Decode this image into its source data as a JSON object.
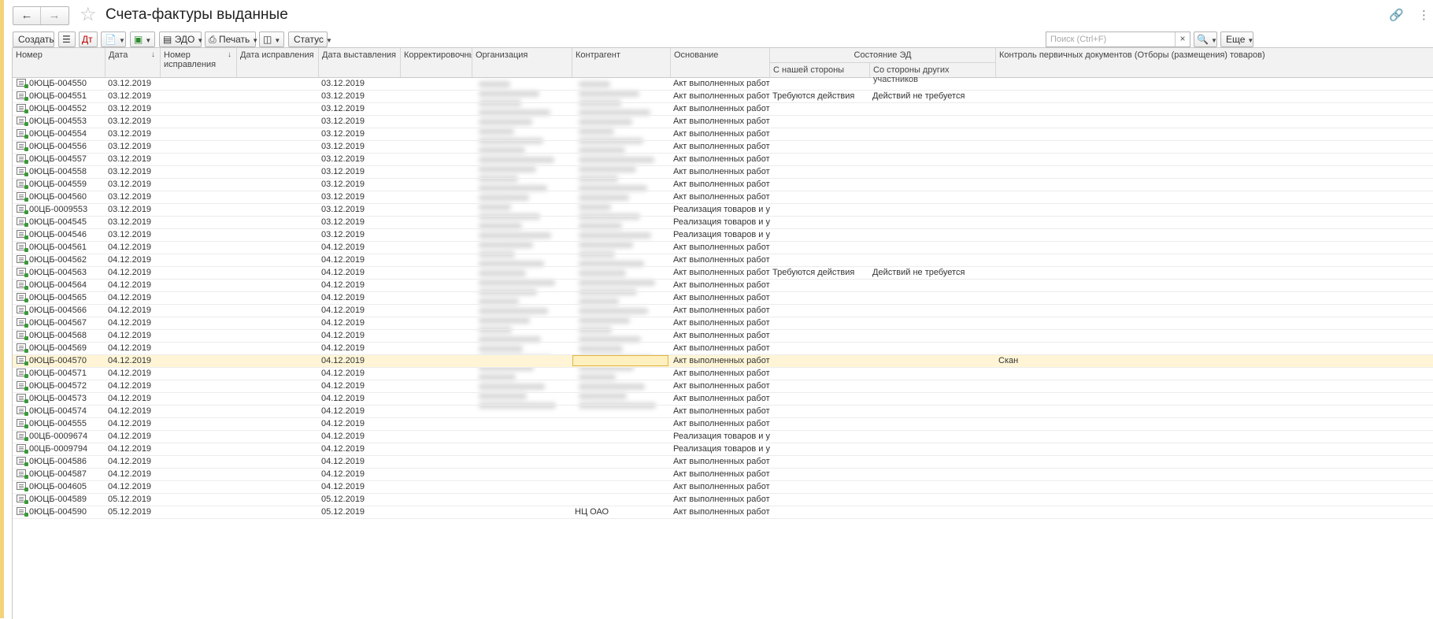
{
  "window": {
    "title": "Счета-фактуры выданные"
  },
  "toolbar": {
    "create_label": "Создать",
    "edo_label": "ЭДО",
    "print_label": "Печать",
    "status_label": "Статус",
    "search_placeholder": "Поиск (Ctrl+F)",
    "more_label": "Еще"
  },
  "columns": {
    "number": "Номер",
    "date": "Дата",
    "corr_number": "Номер исправления",
    "corr_date": "Дата исправления",
    "issue_date": "Дата выставления",
    "corrective": "Корректировочный",
    "organization": "Организация",
    "counterparty": "Контрагент",
    "basis": "Основание",
    "ed_state": "Состояние ЭД",
    "our_side": "С нашей стороны",
    "other_side": "Со стороны других участников",
    "control": "Контроль первичных документов (Отборы (размещения) товаров)"
  },
  "rows": [
    {
      "number": "0ЮЦБ-004550",
      "date": "03.12.2019",
      "issue": "03.12.2019",
      "basis": "Акт выполненных работ ...",
      "our": "",
      "other": "",
      "control": ""
    },
    {
      "number": "0ЮЦБ-004551",
      "date": "03.12.2019",
      "issue": "03.12.2019",
      "basis": "Акт выполненных работ ...",
      "our": "Требуются действия",
      "other": "Действий не требуется",
      "control": ""
    },
    {
      "number": "0ЮЦБ-004552",
      "date": "03.12.2019",
      "issue": "03.12.2019",
      "basis": "Акт выполненных работ ...",
      "our": "",
      "other": "",
      "control": ""
    },
    {
      "number": "0ЮЦБ-004553",
      "date": "03.12.2019",
      "issue": "03.12.2019",
      "basis": "Акт выполненных работ ...",
      "our": "",
      "other": "",
      "control": ""
    },
    {
      "number": "0ЮЦБ-004554",
      "date": "03.12.2019",
      "issue": "03.12.2019",
      "basis": "Акт выполненных работ ...",
      "our": "",
      "other": "",
      "control": ""
    },
    {
      "number": "0ЮЦБ-004556",
      "date": "03.12.2019",
      "issue": "03.12.2019",
      "basis": "Акт выполненных работ ...",
      "our": "",
      "other": "",
      "control": ""
    },
    {
      "number": "0ЮЦБ-004557",
      "date": "03.12.2019",
      "issue": "03.12.2019",
      "basis": "Акт выполненных работ ...",
      "our": "",
      "other": "",
      "control": ""
    },
    {
      "number": "0ЮЦБ-004558",
      "date": "03.12.2019",
      "issue": "03.12.2019",
      "basis": "Акт выполненных работ ...",
      "our": "",
      "other": "",
      "control": ""
    },
    {
      "number": "0ЮЦБ-004559",
      "date": "03.12.2019",
      "issue": "03.12.2019",
      "basis": "Акт выполненных работ ...",
      "our": "",
      "other": "",
      "control": ""
    },
    {
      "number": "0ЮЦБ-004560",
      "date": "03.12.2019",
      "issue": "03.12.2019",
      "basis": "Акт выполненных работ ...",
      "our": "",
      "other": "",
      "control": ""
    },
    {
      "number": "00ЦБ-0009553",
      "date": "03.12.2019",
      "issue": "03.12.2019",
      "basis": "Реализация товаров и ус...",
      "our": "",
      "other": "",
      "control": ""
    },
    {
      "number": "0ЮЦБ-004545",
      "date": "03.12.2019",
      "issue": "03.12.2019",
      "basis": "Реализация товаров и ус...",
      "our": "",
      "other": "",
      "control": ""
    },
    {
      "number": "0ЮЦБ-004546",
      "date": "03.12.2019",
      "issue": "03.12.2019",
      "basis": "Реализация товаров и ус...",
      "our": "",
      "other": "",
      "control": ""
    },
    {
      "number": "0ЮЦБ-004561",
      "date": "04.12.2019",
      "issue": "04.12.2019",
      "basis": "Акт выполненных работ ...",
      "our": "",
      "other": "",
      "control": ""
    },
    {
      "number": "0ЮЦБ-004562",
      "date": "04.12.2019",
      "issue": "04.12.2019",
      "basis": "Акт выполненных работ ...",
      "our": "",
      "other": "",
      "control": ""
    },
    {
      "number": "0ЮЦБ-004563",
      "date": "04.12.2019",
      "issue": "04.12.2019",
      "basis": "Акт выполненных работ ...",
      "our": "Требуются действия",
      "other": "Действий не требуется",
      "control": ""
    },
    {
      "number": "0ЮЦБ-004564",
      "date": "04.12.2019",
      "issue": "04.12.2019",
      "basis": "Акт выполненных работ ...",
      "our": "",
      "other": "",
      "control": ""
    },
    {
      "number": "0ЮЦБ-004565",
      "date": "04.12.2019",
      "issue": "04.12.2019",
      "basis": "Акт выполненных работ ...",
      "our": "",
      "other": "",
      "control": ""
    },
    {
      "number": "0ЮЦБ-004566",
      "date": "04.12.2019",
      "issue": "04.12.2019",
      "basis": "Акт выполненных работ ...",
      "our": "",
      "other": "",
      "control": ""
    },
    {
      "number": "0ЮЦБ-004567",
      "date": "04.12.2019",
      "issue": "04.12.2019",
      "basis": "Акт выполненных работ ...",
      "our": "",
      "other": "",
      "control": ""
    },
    {
      "number": "0ЮЦБ-004568",
      "date": "04.12.2019",
      "issue": "04.12.2019",
      "basis": "Акт выполненных работ ...",
      "our": "",
      "other": "",
      "control": ""
    },
    {
      "number": "0ЮЦБ-004569",
      "date": "04.12.2019",
      "issue": "04.12.2019",
      "basis": "Акт выполненных работ ...",
      "our": "",
      "other": "",
      "control": ""
    },
    {
      "number": "0ЮЦБ-004570",
      "date": "04.12.2019",
      "issue": "04.12.2019",
      "basis": "Акт выполненных работ ...",
      "our": "",
      "other": "",
      "control": "Скан",
      "selected": true
    },
    {
      "number": "0ЮЦБ-004571",
      "date": "04.12.2019",
      "issue": "04.12.2019",
      "basis": "Акт выполненных работ ...",
      "our": "",
      "other": "",
      "control": ""
    },
    {
      "number": "0ЮЦБ-004572",
      "date": "04.12.2019",
      "issue": "04.12.2019",
      "basis": "Акт выполненных работ ...",
      "our": "",
      "other": "",
      "control": ""
    },
    {
      "number": "0ЮЦБ-004573",
      "date": "04.12.2019",
      "issue": "04.12.2019",
      "basis": "Акт выполненных работ ...",
      "our": "",
      "other": "",
      "control": ""
    },
    {
      "number": "0ЮЦБ-004574",
      "date": "04.12.2019",
      "issue": "04.12.2019",
      "basis": "Акт выполненных работ ...",
      "our": "",
      "other": "",
      "control": ""
    },
    {
      "number": "0ЮЦБ-004555",
      "date": "04.12.2019",
      "issue": "04.12.2019",
      "basis": "Акт выполненных работ ...",
      "our": "",
      "other": "",
      "control": ""
    },
    {
      "number": "00ЦБ-0009674",
      "date": "04.12.2019",
      "issue": "04.12.2019",
      "basis": "Реализация товаров и ус...",
      "our": "",
      "other": "",
      "control": ""
    },
    {
      "number": "00ЦБ-0009794",
      "date": "04.12.2019",
      "issue": "04.12.2019",
      "basis": "Реализация товаров и ус...",
      "our": "",
      "other": "",
      "control": ""
    },
    {
      "number": "0ЮЦБ-004586",
      "date": "04.12.2019",
      "issue": "04.12.2019",
      "basis": "Акт выполненных работ ...",
      "our": "",
      "other": "",
      "control": ""
    },
    {
      "number": "0ЮЦБ-004587",
      "date": "04.12.2019",
      "issue": "04.12.2019",
      "basis": "Акт выполненных работ ...",
      "our": "",
      "other": "",
      "control": ""
    },
    {
      "number": "0ЮЦБ-004605",
      "date": "04.12.2019",
      "issue": "04.12.2019",
      "basis": "Акт выполненных работ ...",
      "our": "",
      "other": "",
      "control": ""
    },
    {
      "number": "0ЮЦБ-004589",
      "date": "05.12.2019",
      "issue": "05.12.2019",
      "basis": "Акт выполненных работ ...",
      "our": "",
      "other": "",
      "control": ""
    },
    {
      "number": "0ЮЦБ-004590",
      "date": "05.12.2019",
      "issue": "05.12.2019",
      "basis": "Акт выполненных работ ...",
      "our": "",
      "other": "",
      "control": "",
      "counterparty": "НЦ ОАО"
    }
  ]
}
